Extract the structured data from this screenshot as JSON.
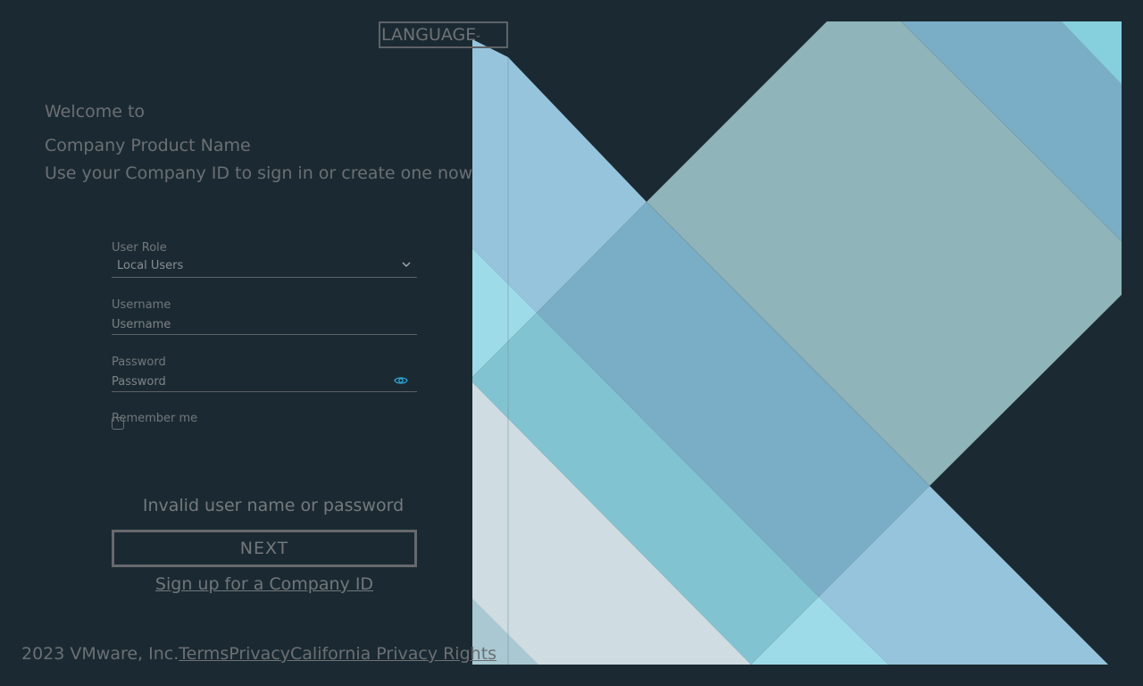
{
  "header": {
    "language_label": "LANGUAGE"
  },
  "intro": {
    "welcome": "Welcome to",
    "product_name": "Company Product Name",
    "subtitle": "Use your Company ID to sign in or create one now"
  },
  "form": {
    "user_role_label": "User Role",
    "user_role_value": "Local Users",
    "username_label": "Username",
    "username_placeholder": "Username",
    "password_label": "Password",
    "password_placeholder": "Password",
    "remember_label": "Remember me",
    "error_message": "Invalid user name or password",
    "next_label": "NEXT",
    "signup_label": "Sign up for a Company ID"
  },
  "footer": {
    "copyright": "2023 VMware, Inc.",
    "terms": "Terms",
    "privacy": "Privacy",
    "california": "California Privacy Rights"
  },
  "colors": {
    "background": "#1b2a32",
    "accent_eye": "#2ea8d8"
  },
  "icons": {
    "language_chevron": "chevron-down-icon",
    "role_chevron": "chevron-down-icon",
    "password_toggle": "eye-icon"
  }
}
